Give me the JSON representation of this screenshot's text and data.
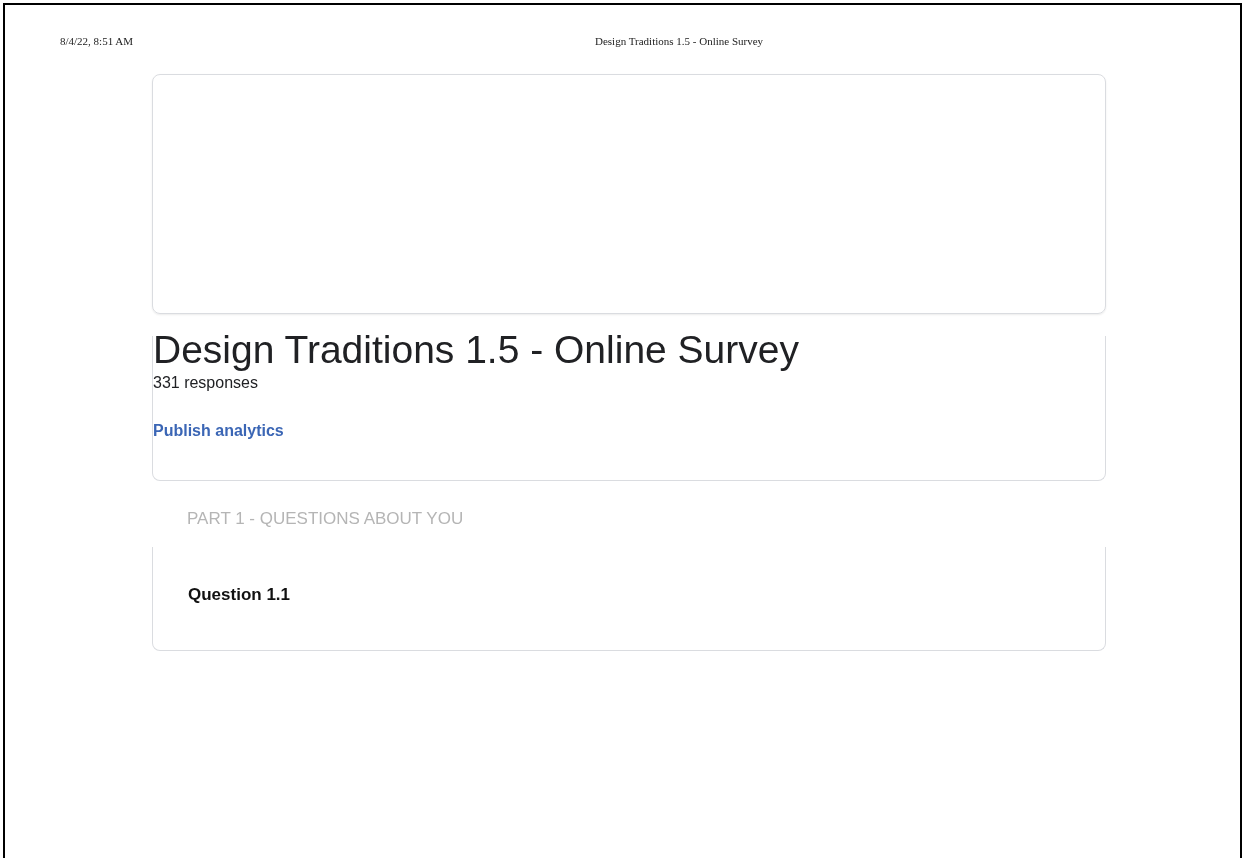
{
  "print_header": {
    "date": "8/4/22, 8:51 AM",
    "title": "Design Traditions 1.5 - Online Survey"
  },
  "form": {
    "title": "Design Traditions 1.5 - Online Survey",
    "responses": "331 responses",
    "publish_link": "Publish analytics"
  },
  "section": {
    "title": "PART 1 - QUESTIONS ABOUT YOU"
  },
  "questions": [
    {
      "title": "Question 1.1"
    }
  ]
}
